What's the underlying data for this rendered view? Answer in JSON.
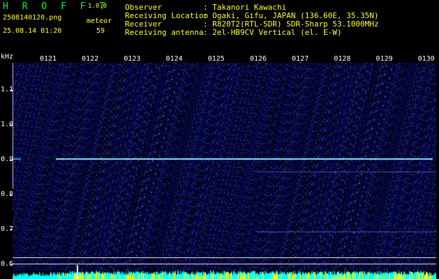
{
  "app": {
    "title": "H R O F F T",
    "version": "1.0.0"
  },
  "file": {
    "name": "2508140120.png",
    "datetime": "25.08.14 01:20",
    "counter_label": "meteor",
    "counter_value": "59"
  },
  "station": {
    "labels": [
      "Observer",
      "Receiving Location",
      "Receiver",
      "Receiving antenna"
    ],
    "values": [
      ": Takanori Kawachi",
      ": Ogaki, Gifu, JAPAN (136.60E, 35.35N)",
      ": R820T2(RTL-SDR) SDR-Sharp 53.1000MHz",
      ": 2el-HB9CV Vertical (el. E-W)"
    ]
  },
  "axis": {
    "y_unit": "kHz",
    "y_ticks": [
      "1.1",
      "1.0",
      "0.9",
      "0.8",
      "0.7",
      "0.6"
    ],
    "x_ticks": [
      "0121",
      "0122",
      "0123",
      "0124",
      "0125",
      "0126",
      "0127",
      "0128",
      "0129",
      "0130"
    ]
  },
  "colors": {
    "text_green": "#00ff33",
    "text_yellow": "#ffff33",
    "background": "#000000",
    "noise": "#1a1a8c",
    "carrier": "#66ccff",
    "spectrum": "#00ffff"
  }
}
